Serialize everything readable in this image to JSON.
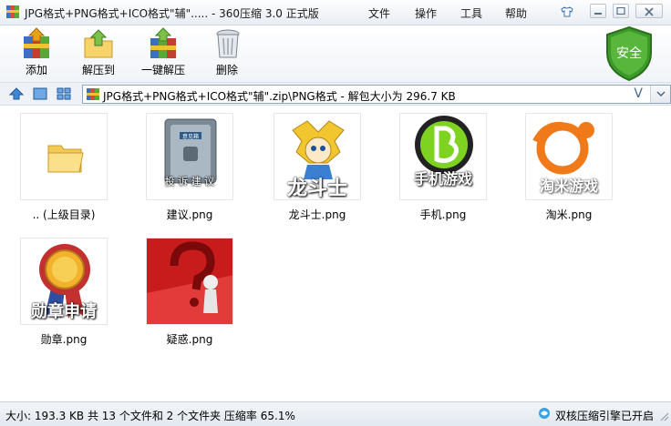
{
  "window": {
    "title": "JPG格式+PNG格式+ICO格式\"辅\"..... - 360压缩 3.0 正式版"
  },
  "menu": {
    "file": "文件",
    "operate": "操作",
    "tools": "工具",
    "help": "帮助"
  },
  "toolbar": {
    "add": "添加",
    "extract_to": "解压到",
    "one_click_extract": "一键解压",
    "delete": "删除",
    "shield": "安全"
  },
  "address": {
    "path": "JPG格式+PNG格式+ICO格式\"辅\".zip\\PNG格式 - 解包大小为 296.7 KB",
    "v_label": "V"
  },
  "files": [
    {
      "name": ".. (上级目录)",
      "icon": "folder-icon"
    },
    {
      "name": "建议.png",
      "caption": "投 诉 建 议",
      "box": "意见箱"
    },
    {
      "name": "龙斗士.png",
      "caption": "龙斗士"
    },
    {
      "name": "手机.png",
      "caption": "手机游戏"
    },
    {
      "name": "淘米.png",
      "caption": "淘米游戏"
    },
    {
      "name": "勋章.png",
      "caption": "勋章申请"
    },
    {
      "name": "疑惑.png"
    }
  ],
  "status": {
    "left": "大小: 193.3 KB 共 13 个文件和 2 个文件夹 压缩率 65.1%",
    "right": "双核压缩引擎已开启"
  },
  "colors": {
    "accent": "#2f6db5",
    "shield_green": "#3d9a2a"
  }
}
